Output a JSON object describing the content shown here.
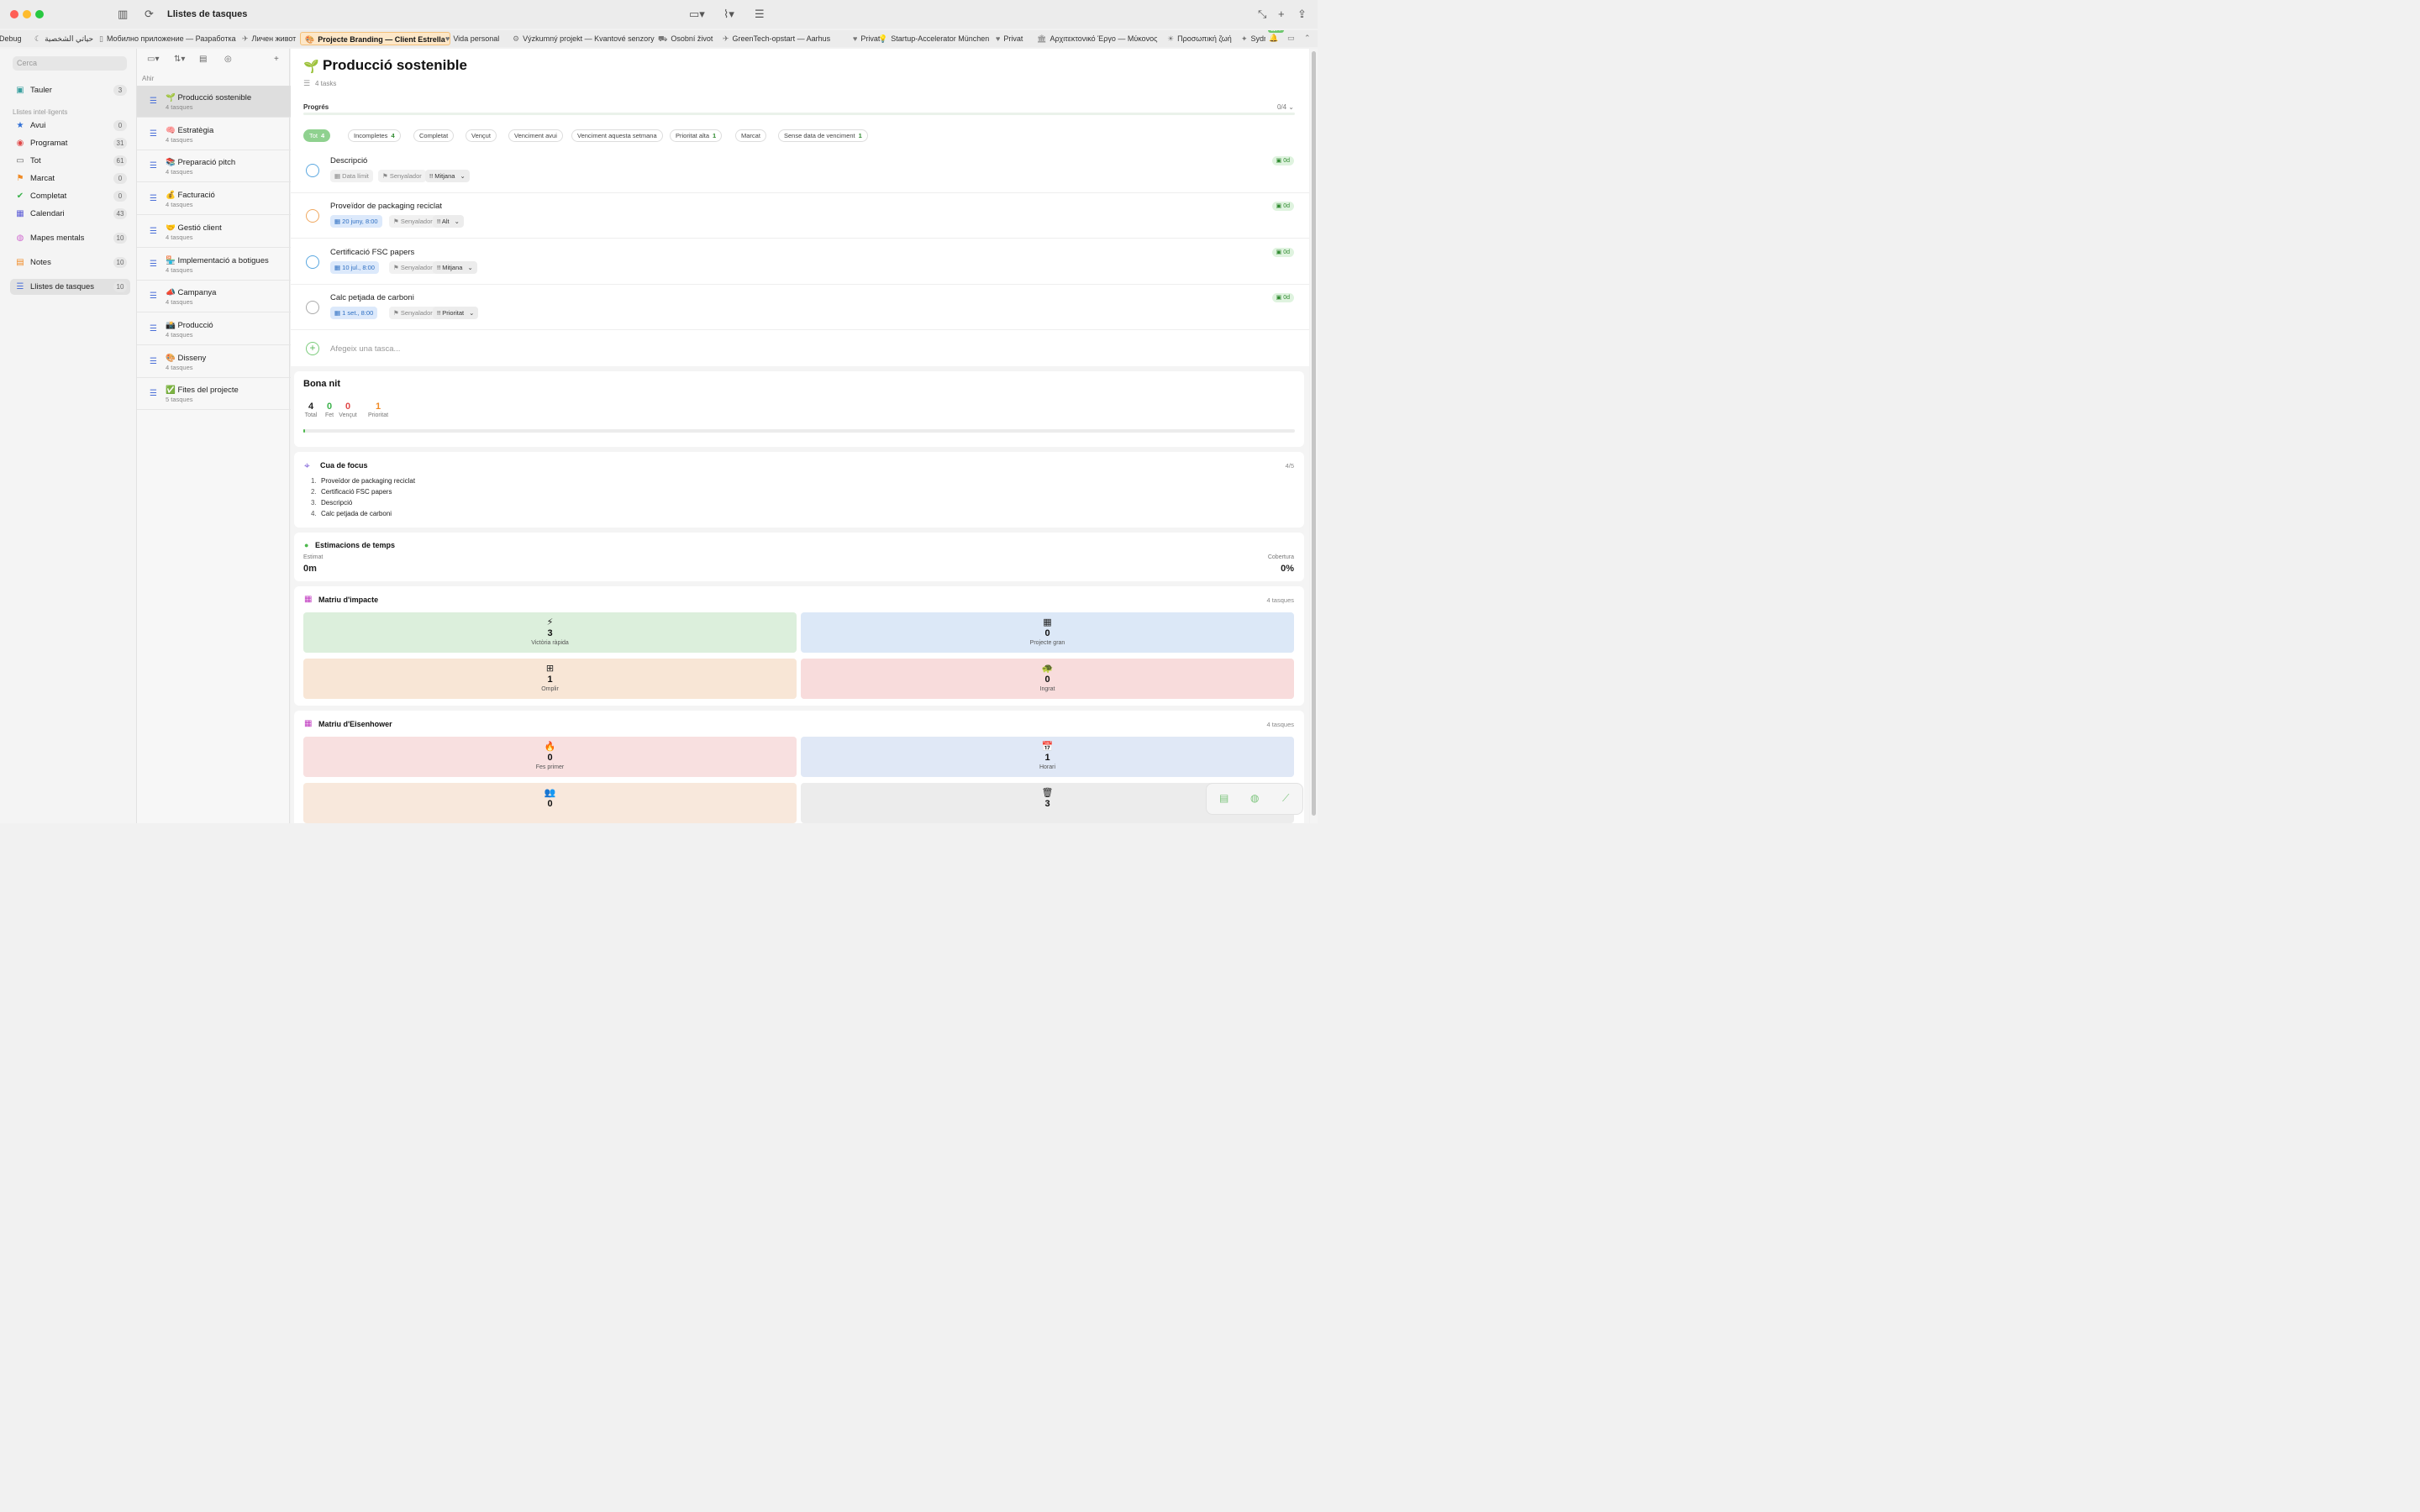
{
  "window": {
    "title": "Llistes de tasques"
  },
  "tabs": [
    {
      "label": "Debug",
      "icon": ""
    },
    {
      "label": "حياتي الشخصية",
      "icon": "☾"
    },
    {
      "label": "Мобилно приложение — Разработка",
      "icon": "▯"
    },
    {
      "label": "Личен живот",
      "icon": "✈"
    },
    {
      "label": "Projecte Branding — Client Estrella",
      "icon": "🎨"
    },
    {
      "label": "Vida personal",
      "icon": "♥"
    },
    {
      "label": "Výzkumný projekt — Kvantové senzory",
      "icon": "⚙"
    },
    {
      "label": "Osobní život",
      "icon": "⛟"
    },
    {
      "label": "GreenTech-opstart — Aarhus",
      "icon": "✈"
    },
    {
      "label": "Privat",
      "icon": "♥"
    },
    {
      "label": "Startup-Accelerator München",
      "icon": "💡"
    },
    {
      "label": "Privat",
      "icon": "♥"
    },
    {
      "label": "Αρχιτεκτονικό Έργο — Μύκονος",
      "icon": "🏛"
    },
    {
      "label": "Προσωπική ζωή",
      "icon": "☀"
    },
    {
      "label": "Sydr",
      "icon": "✦"
    }
  ],
  "notification_count": "1177",
  "sidebar": {
    "search_placeholder": "Cerca",
    "board": {
      "label": "Tauler",
      "count": "3"
    },
    "section_label": "Llistes intel·ligents",
    "smart": [
      {
        "label": "Avui",
        "count": "0",
        "icon": "star-icon",
        "color": "#2f6fd6"
      },
      {
        "label": "Programat",
        "count": "31",
        "icon": "calendar-dot-icon",
        "color": "#e04848"
      },
      {
        "label": "Tot",
        "count": "61",
        "icon": "inbox-icon",
        "color": "#666666"
      },
      {
        "label": "Marcat",
        "count": "0",
        "icon": "flag-icon",
        "color": "#f08a24"
      },
      {
        "label": "Completat",
        "count": "0",
        "icon": "check-circle-icon",
        "color": "#3ab14a"
      },
      {
        "label": "Calendari",
        "count": "43",
        "icon": "calendar-icon",
        "color": "#5b5bd6"
      }
    ],
    "other": [
      {
        "label": "Mapes mentals",
        "count": "10",
        "icon": "brain-icon",
        "color": "#d06ad0"
      },
      {
        "label": "Notes",
        "count": "10",
        "icon": "notes-icon",
        "color": "#f08a24"
      },
      {
        "label": "Llistes de tasques",
        "count": "10",
        "icon": "checklist-icon",
        "color": "#4a6fd8"
      }
    ]
  },
  "middle": {
    "section_header": "Ahir",
    "lists": [
      {
        "name": "🌱 Producció sostenible",
        "sub": "4 tasques"
      },
      {
        "name": "🧠 Estratègia",
        "sub": "4 tasques"
      },
      {
        "name": "📚 Preparació pitch",
        "sub": "4 tasques"
      },
      {
        "name": "💰 Facturació",
        "sub": "4 tasques"
      },
      {
        "name": "🤝 Gestió client",
        "sub": "4 tasques"
      },
      {
        "name": "🏪 Implementació a botigues",
        "sub": "4 tasques"
      },
      {
        "name": "📣 Campanya",
        "sub": "4 tasques"
      },
      {
        "name": "📸 Producció",
        "sub": "4 tasques"
      },
      {
        "name": "🎨 Disseny",
        "sub": "4 tasques"
      },
      {
        "name": "✅ Fites del projecte",
        "sub": "5 tasques"
      }
    ]
  },
  "main": {
    "title": "Producció sostenible",
    "title_icon": "🌱",
    "task_count": "4 tasks",
    "progress": {
      "label": "Progrés",
      "count": "0/4",
      "fraction": 0.0
    },
    "filters": [
      {
        "label": "Tot",
        "count": "4",
        "on": true
      },
      {
        "label": "Incompletes",
        "count": "4",
        "on": false
      },
      {
        "label": "Completat",
        "count": "",
        "on": false
      },
      {
        "label": "Vençut",
        "count": "",
        "on": false
      },
      {
        "label": "Venciment avui",
        "count": "",
        "on": false
      },
      {
        "label": "Venciment aquesta setmana",
        "count": "",
        "on": false
      },
      {
        "label": "Prioritat alta",
        "count": "1",
        "on": false
      },
      {
        "label": "Marcat",
        "count": "",
        "on": false
      },
      {
        "label": "Sense data de venciment",
        "count": "1",
        "on": false
      }
    ],
    "tasks": [
      {
        "title": "Descripció",
        "date": "Data límit",
        "flag": "Senyalador",
        "priority": "!! Mitjana",
        "badge": "0d",
        "circle_color": "#5aa7e0",
        "has_date": false
      },
      {
        "title": "Proveïdor de packaging reciclat",
        "date": "20 juny, 8:00",
        "flag": "Senyalador",
        "priority": "!! Alt",
        "badge": "0d",
        "circle_color": "#f0a860",
        "has_date": true
      },
      {
        "title": "Certificació FSC papers",
        "date": "10 jul., 8:00",
        "flag": "Senyalador",
        "priority": "!! Mitjana",
        "badge": "0d",
        "circle_color": "#5aa7e0",
        "has_date": true
      },
      {
        "title": "Calc petjada de carboni",
        "date": "1 set., 8:00",
        "flag": "Senyalador",
        "priority": "!! Prioritat",
        "badge": "0d",
        "circle_color": "#aaaaaa",
        "has_date": true
      }
    ],
    "add_placeholder": "Afegeix una tasca...",
    "summary": {
      "title": "Bona nit",
      "stats": [
        {
          "n": "4",
          "label": "Total",
          "color": "#222222"
        },
        {
          "n": "0",
          "label": "Fet",
          "color": "#3ab14a"
        },
        {
          "n": "0",
          "label": "Vençut",
          "color": "#e04848"
        },
        {
          "n": "1",
          "label": "Prioritat",
          "color": "#f08a24"
        }
      ]
    },
    "focus": {
      "title": "Cua de focus",
      "count": "4/5",
      "items": [
        "Proveïdor de packaging reciclat",
        "Certificació FSC papers",
        "Descripció",
        "Calc petjada de carboni"
      ]
    },
    "estimates": {
      "title": "Estimacions de temps",
      "est_label": "Estimat",
      "est_value": "0m",
      "cov_label": "Cobertura",
      "cov_value": "0%"
    },
    "impact": {
      "title": "Matriu d'impacte",
      "count": "4 tasques",
      "tiles": [
        {
          "n": "3",
          "label": "Victòria ràpida",
          "icon": "⚡",
          "bg": "#dcefdc"
        },
        {
          "n": "0",
          "label": "Projecte gran",
          "icon": "▦",
          "bg": "#dce8f7"
        },
        {
          "n": "1",
          "label": "Omplir",
          "icon": "⊞",
          "bg": "#f8e6d6"
        },
        {
          "n": "0",
          "label": "Ingrat",
          "icon": "🐢",
          "bg": "#f8dcdc"
        }
      ]
    },
    "eisenhower": {
      "title": "Matriu d'Eisenhower",
      "count": "4 tasques",
      "tiles": [
        {
          "n": "0",
          "label": "Fes primer",
          "icon": "🔥",
          "bg": "#f8e0e0"
        },
        {
          "n": "1",
          "label": "Horari",
          "icon": "📅",
          "bg": "#e0e8f6"
        },
        {
          "n": "0",
          "label": "",
          "icon": "👥",
          "bg": "#f8e8dc"
        },
        {
          "n": "3",
          "label": "",
          "icon": "🗑",
          "bg": "#ececec"
        }
      ]
    }
  }
}
